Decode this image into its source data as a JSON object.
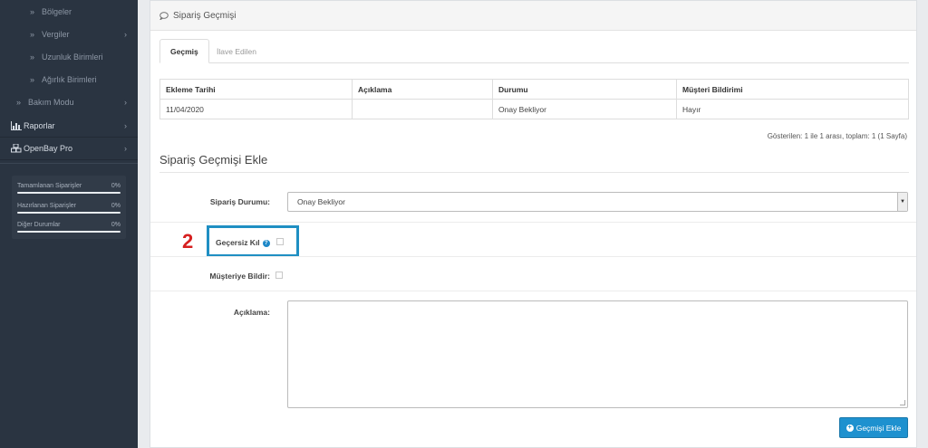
{
  "sidebar": {
    "sub_items": [
      {
        "label": "Bölgeler",
        "has_children": false
      },
      {
        "label": "Vergiler",
        "has_children": true
      },
      {
        "label": "Uzunluk Birimleri",
        "has_children": false
      },
      {
        "label": "Ağırlık Birimleri",
        "has_children": false
      }
    ],
    "bakim": {
      "label": "Bakım Modu",
      "has_children": true
    },
    "raporlar": {
      "label": "Raporlar",
      "icon": "bar-chart-icon"
    },
    "openbay": {
      "label": "OpenBay Pro",
      "icon": "cubes-icon"
    },
    "stats": [
      {
        "label": "Tamamlanan Siparişler",
        "percent": "0%",
        "progress": 0
      },
      {
        "label": "Hazırlanan Siparişler",
        "percent": "0%",
        "progress": 0
      },
      {
        "label": "Diğer Durumlar",
        "percent": "0%",
        "progress": 0
      }
    ]
  },
  "panel": {
    "title": "Sipariş Geçmişi",
    "title_icon": "comment-icon"
  },
  "tabs": {
    "history": "Geçmiş",
    "additional": "İlave Edilen"
  },
  "history_table": {
    "headers": [
      "Ekleme Tarihi",
      "Açıklama",
      "Durumu",
      "Müşteri Bildirimi"
    ],
    "rows": [
      [
        "11/04/2020",
        "",
        "Onay Bekliyor",
        "Hayır"
      ]
    ]
  },
  "pager_info": "Gösterilen: 1 ile 1 arası, toplam: 1 (1 Sayfa)",
  "add_form": {
    "heading": "Sipariş Geçmişi Ekle",
    "status_label": "Sipariş Durumu:",
    "status_value": "Onay Bekliyor",
    "invalidate_label": "Geçersiz Kıl",
    "invalidate_help": "?",
    "notify_label": "Müşteriye Bildir:",
    "comment_label": "Açıklama:",
    "comment_value": "",
    "submit_label": "Geçmişi Ekle"
  },
  "annotation": {
    "step_number": "2",
    "highlight_color": "#1f8fc3",
    "number_color": "#d62020"
  },
  "colors": {
    "sidebar_bg": "#2a3441",
    "accent": "#1e91cf"
  }
}
